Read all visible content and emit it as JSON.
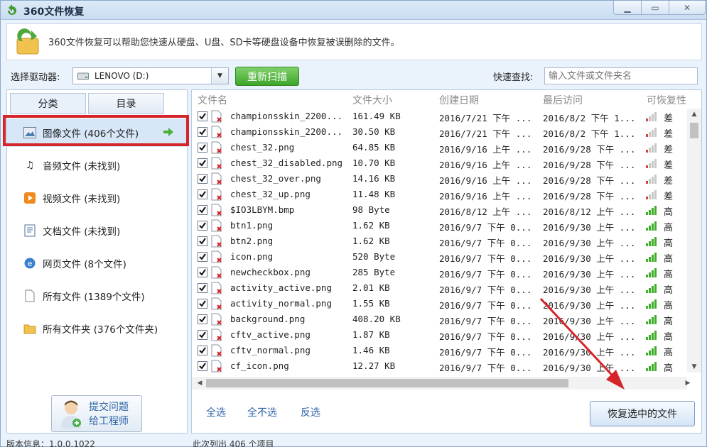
{
  "window": {
    "title": "360文件恢复"
  },
  "banner": {
    "text": "360文件恢复可以帮助您快速从硬盘、U盘、SD卡等硬盘设备中恢复被误删除的文件。"
  },
  "toolbar": {
    "drive_label": "选择驱动器:",
    "drive_value": "LENOVO (D:)",
    "rescan_label": "重新扫描",
    "quick_search_label": "快速查找:",
    "quick_search_placeholder": "输入文件或文件夹名"
  },
  "left": {
    "tabs": [
      "分类",
      "目录"
    ],
    "categories": [
      {
        "label": "图像文件 (406个文件)",
        "icon": "image-icon",
        "selected": true
      },
      {
        "label": "音频文件 (未找到)",
        "icon": "music-icon"
      },
      {
        "label": "视频文件 (未找到)",
        "icon": "video-icon"
      },
      {
        "label": "文档文件 (未找到)",
        "icon": "document-icon"
      },
      {
        "label": "网页文件 (8个文件)",
        "icon": "webpage-icon"
      },
      {
        "label": "所有文件 (1389个文件)",
        "icon": "file-icon"
      },
      {
        "label": "所有文件夹 (376个文件夹)",
        "icon": "folder-icon"
      }
    ],
    "support": {
      "line1": "提交问题",
      "line2": "给工程师"
    }
  },
  "table": {
    "columns": [
      "文件名",
      "文件大小",
      "创建日期",
      "最后访问",
      "可恢复性"
    ],
    "rows": [
      {
        "name": "championsskin_2200...",
        "size": "161.49 KB",
        "created": "2016/7/21 下午 ...",
        "accessed": "2016/8/2 下午 1...",
        "rec": "差"
      },
      {
        "name": "championsskin_2200...",
        "size": "30.50 KB",
        "created": "2016/7/21 下午 ...",
        "accessed": "2016/8/2 下午 1...",
        "rec": "差"
      },
      {
        "name": "chest_32.png",
        "size": "64.85 KB",
        "created": "2016/9/16 上午 ...",
        "accessed": "2016/9/28 下午 ...",
        "rec": "差"
      },
      {
        "name": "chest_32_disabled.png",
        "size": "10.70 KB",
        "created": "2016/9/16 上午 ...",
        "accessed": "2016/9/28 下午 ...",
        "rec": "差"
      },
      {
        "name": "chest_32_over.png",
        "size": "14.16 KB",
        "created": "2016/9/16 上午 ...",
        "accessed": "2016/9/28 下午 ...",
        "rec": "差"
      },
      {
        "name": "chest_32_up.png",
        "size": "11.48 KB",
        "created": "2016/9/16 上午 ...",
        "accessed": "2016/9/28 下午 ...",
        "rec": "差"
      },
      {
        "name": "$IO3LBYM.bmp",
        "size": "98 Byte",
        "created": "2016/8/12 上午 ...",
        "accessed": "2016/8/12 上午 ...",
        "rec": "高"
      },
      {
        "name": "btn1.png",
        "size": "1.62 KB",
        "created": "2016/9/7 下午 0...",
        "accessed": "2016/9/30 上午 ...",
        "rec": "高"
      },
      {
        "name": "btn2.png",
        "size": "1.62 KB",
        "created": "2016/9/7 下午 0...",
        "accessed": "2016/9/30 上午 ...",
        "rec": "高"
      },
      {
        "name": "icon.png",
        "size": "520 Byte",
        "created": "2016/9/7 下午 0...",
        "accessed": "2016/9/30 上午 ...",
        "rec": "高"
      },
      {
        "name": "newcheckbox.png",
        "size": "285 Byte",
        "created": "2016/9/7 下午 0...",
        "accessed": "2016/9/30 上午 ...",
        "rec": "高"
      },
      {
        "name": "activity_active.png",
        "size": "2.01 KB",
        "created": "2016/9/7 下午 0...",
        "accessed": "2016/9/30 上午 ...",
        "rec": "高"
      },
      {
        "name": "activity_normal.png",
        "size": "1.55 KB",
        "created": "2016/9/7 下午 0...",
        "accessed": "2016/9/30 上午 ...",
        "rec": "高"
      },
      {
        "name": "background.png",
        "size": "408.20 KB",
        "created": "2016/9/7 下午 0...",
        "accessed": "2016/9/30 上午 ...",
        "rec": "高"
      },
      {
        "name": "cftv_active.png",
        "size": "1.87 KB",
        "created": "2016/9/7 下午 0...",
        "accessed": "2016/9/30 上午 ...",
        "rec": "高"
      },
      {
        "name": "cftv_normal.png",
        "size": "1.46 KB",
        "created": "2016/9/7 下午 0...",
        "accessed": "2016/9/30 上午 ...",
        "rec": "高"
      },
      {
        "name": "cf_icon.png",
        "size": "12.27 KB",
        "created": "2016/9/7 下午 0...",
        "accessed": "2016/9/30 上午 ...",
        "rec": "高"
      }
    ]
  },
  "actions": {
    "select_all": "全选",
    "select_none": "全不选",
    "invert": "反选",
    "recover": "恢复选中的文件"
  },
  "status": {
    "version": "版本信息：1.0.0.1022",
    "count": "此次列出 406 个项目"
  },
  "colors": {
    "accent_green": "#3ea52a",
    "selection_red": "#d6252a",
    "link_blue": "#2a62a5"
  }
}
